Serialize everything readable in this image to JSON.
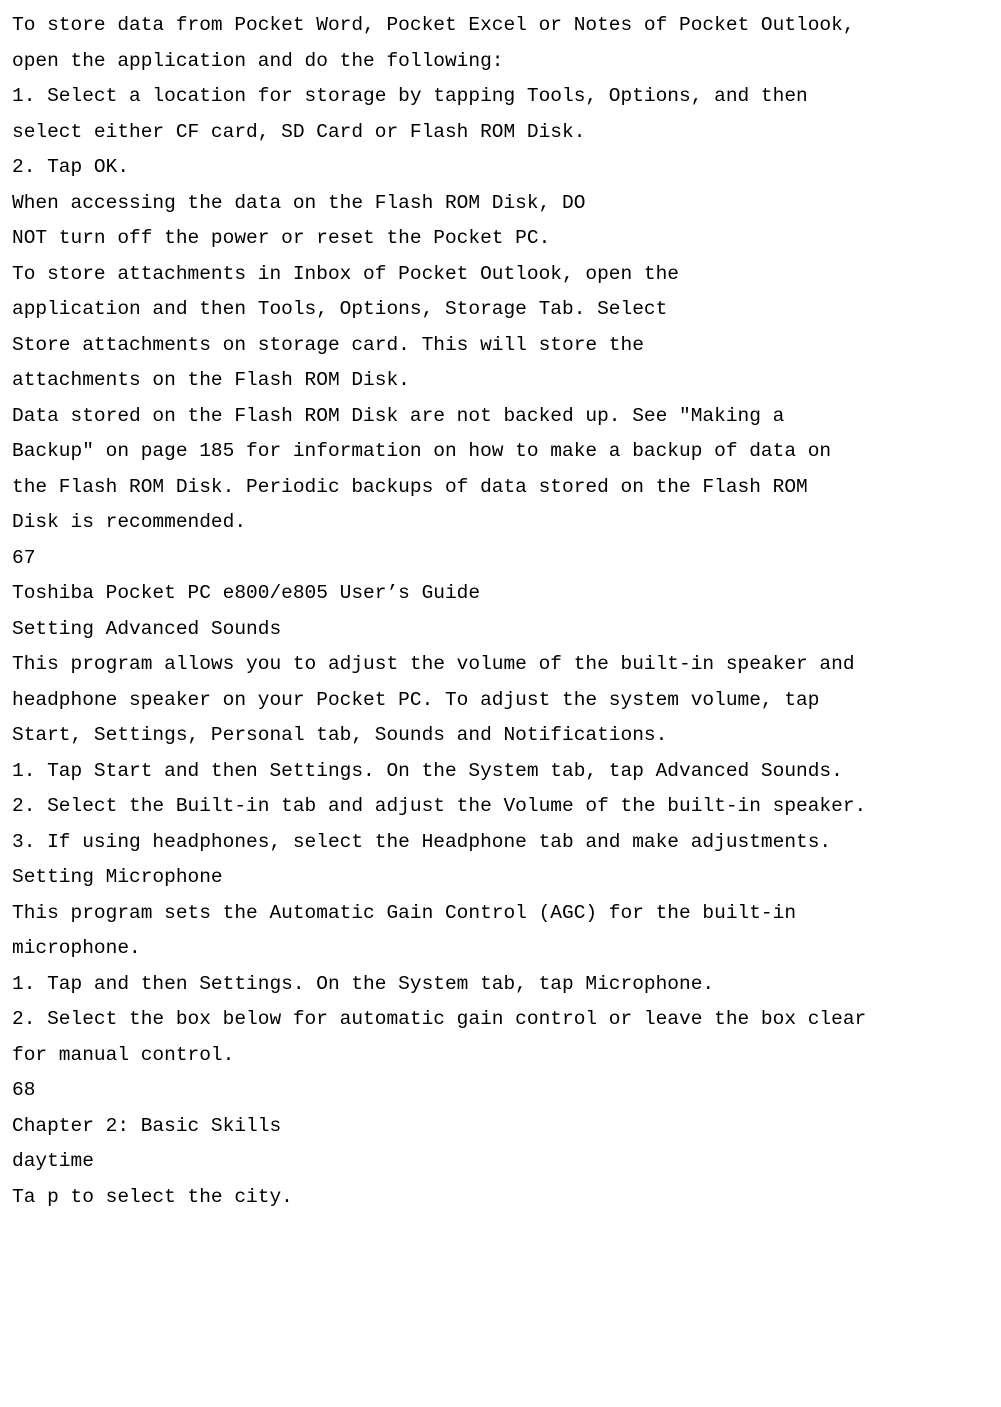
{
  "lines": [
    "To store data from Pocket Word, Pocket Excel or Notes of Pocket Outlook,",
    "open the application and do the following:",
    "1. Select a location for storage by tapping Tools, Options, and then",
    "select either CF card, SD Card or Flash ROM Disk.",
    "2. Tap OK.",
    "When accessing the data on the Flash ROM Disk, DO",
    "NOT turn off the power or reset the Pocket PC.",
    "To store attachments in Inbox of Pocket Outlook, open the",
    "application and then Tools, Options, Storage Tab. Select",
    "Store attachments on storage card. This will store the",
    "attachments on the Flash ROM Disk.",
    "Data stored on the Flash ROM Disk are not backed up. See \"Making a",
    "Backup\" on page 185 for information on how to make a backup of data on",
    "the Flash ROM Disk. Periodic backups of data stored on the Flash ROM",
    "Disk is recommended.",
    "67",
    "Toshiba Pocket PC e800/e805 User’s Guide",
    "Setting Advanced Sounds",
    "This program allows you to adjust the volume of the built-in speaker and",
    "headphone speaker on your Pocket PC. To adjust the system volume, tap",
    "Start, Settings, Personal tab, Sounds and Notifications.",
    "1. Tap Start and then Settings. On the System tab, tap Advanced Sounds.",
    "2. Select the Built-in tab and adjust the Volume of the built-in speaker.",
    "3. If using headphones, select the Headphone tab and make adjustments.",
    "Setting Microphone",
    "This program sets the Automatic Gain Control (AGC) for the built-in",
    "microphone.",
    "1. Tap and then Settings. On the System tab, tap Microphone.",
    "2. Select the box below for automatic gain control or leave the box clear",
    "for manual control.",
    "68",
    "Chapter 2: Basic Skills",
    "daytime",
    "Ta p to select the city."
  ]
}
